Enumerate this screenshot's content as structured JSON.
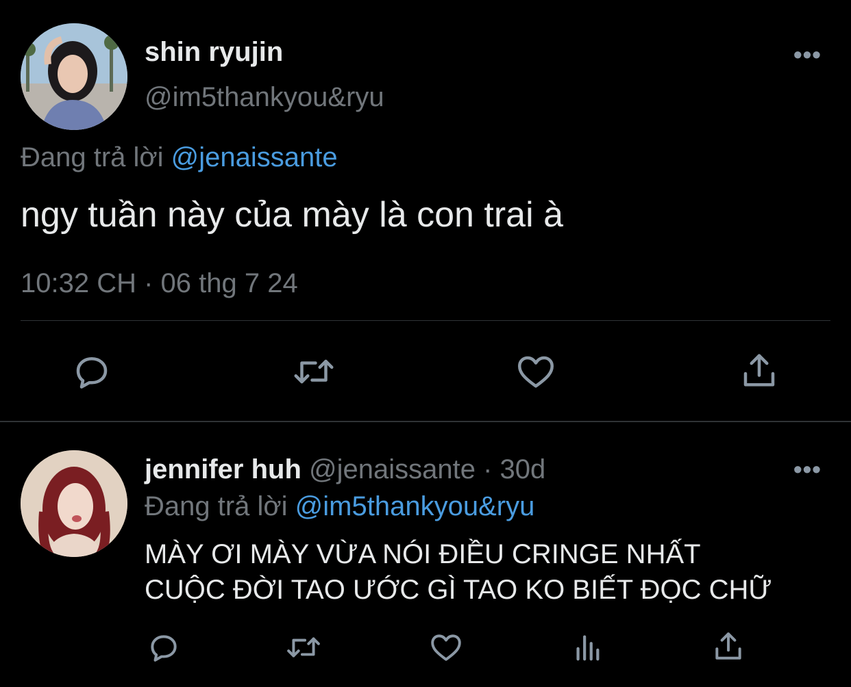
{
  "main_tweet": {
    "display_name": "shin ryujin",
    "handle": "@im5thankyou&ryu",
    "replying_label": "Đang trả lời",
    "replying_to": "@jenaissante",
    "text": "ngy tuần này của mày là con trai à",
    "timestamp": "10:32 CH · 06 thg 7 24",
    "more_icon": "more-horizontal-icon",
    "actions": [
      "reply-icon",
      "retweet-icon",
      "like-icon",
      "share-icon"
    ]
  },
  "reply_tweet": {
    "display_name": "jennifer huh",
    "handle_time": "@jenaissante · 30d",
    "replying_label": "Đang trả lời",
    "replying_to": "@im5thankyou&ryu",
    "text": "MÀY ƠI MÀY VỪA NÓI ĐIỀU CRINGE NHẤT\nCUỘC ĐỜI TAO ƯỚC GÌ TAO KO BIẾT ĐỌC CHỮ",
    "more_icon": "more-horizontal-icon",
    "actions": [
      "reply-icon",
      "retweet-icon",
      "like-icon",
      "analytics-icon",
      "share-icon"
    ]
  },
  "colors": {
    "background": "#000000",
    "primary_text": "#e7e9ea",
    "secondary_text": "#71767b",
    "link": "#4a9ce0",
    "icon": "#8b98a5",
    "divider": "#2f3336"
  }
}
